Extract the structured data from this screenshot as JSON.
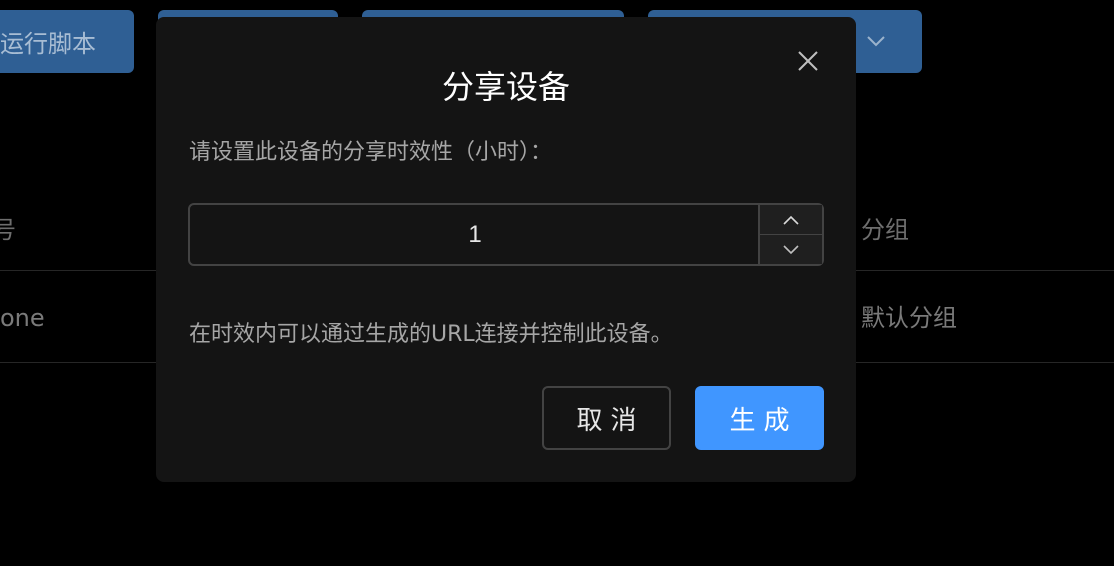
{
  "background": {
    "toolbar": {
      "run_script_label": "运行脚本"
    },
    "table": {
      "header_col1_fragment": "号",
      "header_group": "分组",
      "row1_col1_fragment": "one",
      "row1_group": "默认分组"
    }
  },
  "modal": {
    "title": "分享设备",
    "prompt": "请设置此设备的分享时效性（小时）：",
    "hours_value": "1",
    "hint": "在时效内可以通过生成的URL连接并控制此设备。",
    "cancel_label": "取消",
    "generate_label": "生成"
  },
  "colors": {
    "primary": "#4096ff",
    "modal_bg": "#141414",
    "border": "#434343"
  },
  "icons": {
    "close": "close-icon",
    "step_up": "chevron-up-icon",
    "step_down": "chevron-down-icon"
  }
}
